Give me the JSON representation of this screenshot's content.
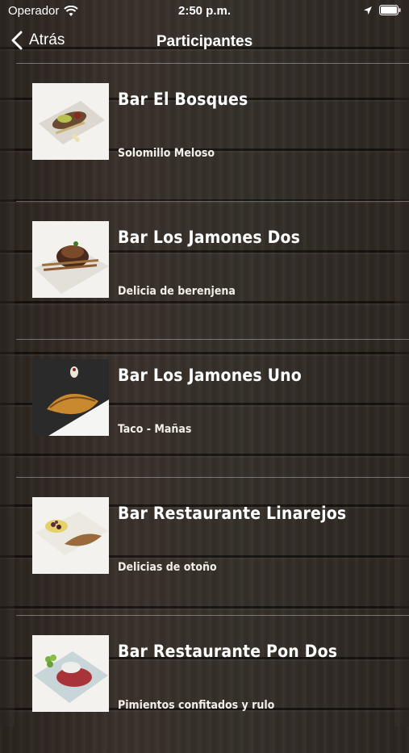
{
  "status_bar": {
    "carrier": "Operador",
    "time": "2:50 p.m."
  },
  "nav": {
    "back_label": "Atrás",
    "title": "Participantes"
  },
  "items": [
    {
      "title": "Bar El Bosques",
      "subtitle": "Solomillo Meloso"
    },
    {
      "title": "Bar Los Jamones Dos",
      "subtitle": "Delicia de berenjena"
    },
    {
      "title": "Bar Los Jamones Uno",
      "subtitle": "Taco - Mañas"
    },
    {
      "title": "Bar Restaurante Linarejos",
      "subtitle": "Delicias de otoño"
    },
    {
      "title": "Bar Restaurante Pon Dos",
      "subtitle": "Pimientos confitados y rulo"
    }
  ]
}
